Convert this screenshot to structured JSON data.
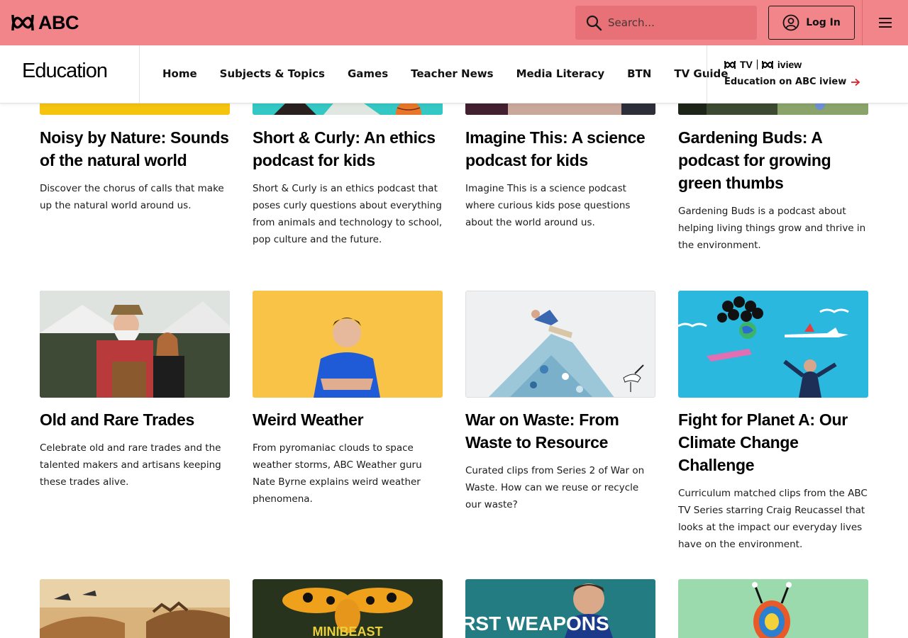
{
  "header": {
    "brand": "ABC",
    "search_placeholder": "Search...",
    "login_label": "Log In"
  },
  "subnav": {
    "section_title": "Education",
    "links": [
      "Home",
      "Subjects & Topics",
      "Games",
      "Teacher News",
      "Media Literacy",
      "BTN",
      "TV Guide"
    ],
    "promo_logo_tv": "TV",
    "promo_logo_iview": "iview",
    "promo_link": "Education on ABC iview"
  },
  "cards_row1": [
    {
      "title": "Noisy by Nature: Sounds of the natural world",
      "desc": "Discover the chorus of calls that make up the natural world around us.",
      "color": "#f5c40f"
    },
    {
      "title": "Short & Curly: An ethics podcast for kids",
      "desc": "Short & Curly is an ethics podcast that poses curly questions about everything from animals and technology to school, pop culture and the future.",
      "color": "#2fc3c0"
    },
    {
      "title": "Imagine This: A science podcast for kids",
      "desc": "Imagine This is a science podcast where curious kids pose questions about the world around us.",
      "color": "#4a1f3a"
    },
    {
      "title": "Gardening Buds: A podcast for growing green thumbs",
      "desc": "Gardening Buds is a podcast about helping living things grow and thrive in the environment.",
      "color": "#2b3a2c"
    }
  ],
  "cards_row2": [
    {
      "title": "Old and Rare Trades",
      "desc": "Celebrate old and rare trades and the talented makers and artisans keeping these trades alive.",
      "color": "#5d6b4f"
    },
    {
      "title": "Weird Weather",
      "desc": "From pyromaniac clouds to space weather storms, ABC Weather guru Nate Byrne explains weird weather phenomena.",
      "color": "#f9c347"
    },
    {
      "title": "War on Waste: From Waste to Resource",
      "desc": "Curated clips from Series 2 of War on Waste. How can we reuse or recycle our waste?",
      "color": "#eceef0"
    },
    {
      "title": "Fight for Planet A: Our Climate Change Challenge",
      "desc": "Curriculum matched clips from the ABC TV Series starring Craig Reucassel that looks at the impact our everyday lives have on the environment.",
      "color": "#2bb8de"
    }
  ],
  "cards_row3": [
    {
      "title": "",
      "color": "#c99448"
    },
    {
      "title": "MINIBEAST",
      "color": "#1f2a18"
    },
    {
      "title": "FIRST WEAPONS",
      "color": "#1c6e74"
    },
    {
      "title": "",
      "color": "#7fd3b0"
    }
  ]
}
